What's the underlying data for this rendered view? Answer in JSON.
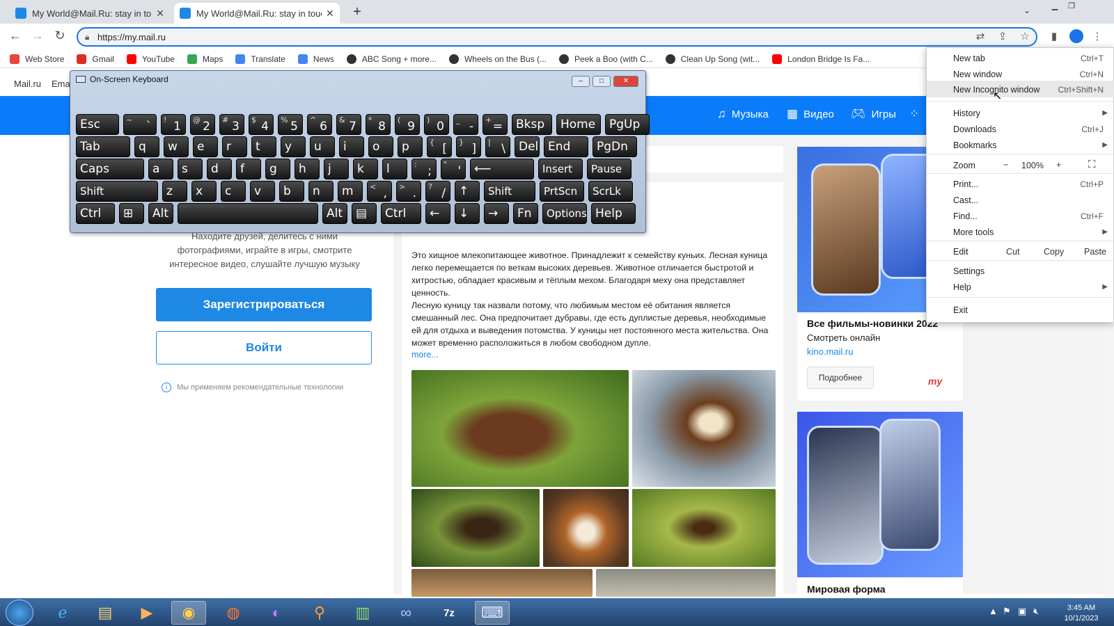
{
  "browser": {
    "tabs": [
      {
        "title": "My World@Mail.Ru: stay in touch",
        "active": false
      },
      {
        "title": "My World@Mail.Ru: stay in touch",
        "active": true
      }
    ],
    "new_tab_symbol": "+",
    "url": "https://my.mail.ru",
    "bookmarks": [
      {
        "label": "Web Store",
        "icon": "webstore-icon",
        "color": "#e8453c"
      },
      {
        "label": "Gmail",
        "icon": "gmail-icon",
        "color": "#d93025"
      },
      {
        "label": "YouTube",
        "icon": "youtube-icon",
        "color": "#ff0000"
      },
      {
        "label": "Maps",
        "icon": "maps-icon",
        "color": "#34a853"
      },
      {
        "label": "Translate",
        "icon": "translate-icon",
        "color": "#4285f4"
      },
      {
        "label": "News",
        "icon": "news-icon",
        "color": "#4285f4"
      },
      {
        "label": "ABC Song + more...",
        "icon": "globe-icon",
        "color": "#333333"
      },
      {
        "label": "Wheels on the Bus (...",
        "icon": "globe-icon",
        "color": "#333333"
      },
      {
        "label": "Peek a Boo (with C...",
        "icon": "globe-icon",
        "color": "#333333"
      },
      {
        "label": "Clean Up Song (wit...",
        "icon": "globe-icon",
        "color": "#333333"
      },
      {
        "label": "London Bridge Is Fa...",
        "icon": "youtube-icon",
        "color": "#ff0000"
      }
    ]
  },
  "site": {
    "nav_left": [
      "Mail.ru",
      "Ema"
    ],
    "blue_nav": [
      {
        "label": "Музыка",
        "icon": "music-icon"
      },
      {
        "label": "Видео",
        "icon": "video-icon"
      },
      {
        "label": "Игры",
        "icon": "gamepad-icon"
      }
    ],
    "intro_lines": [
      "Находите друзей, делитесь с ними",
      "фотографиями, играйте в игры, смотрите",
      "интересное видео, слушайте лучшую музыку"
    ],
    "register_button": "Зарегистрироваться",
    "login_button": "Войти",
    "tech_note": "Мы применяем рекомендательные технологии",
    "article_p1": "Это хищное млекопитающее животное. Принадлежит к семейству куньих. Лесная куница легко перемещается по веткам высоких деревьев. Животное отличается быстротой и хитростью, обладает красивым и тёплым мехом. Благодаря меху она представляет ценность.",
    "article_p2": "Лесную куницу так назвали потому, что любимым местом её обитания является смешанный лес. Она предпочитает дубравы, где есть дуплистые деревья, необходимые ей для отдыха и выведения потомства. У куницы нет постоянного места жительства. Она может временно расположиться в любом свободном дупле.",
    "more_link": "more...",
    "ad1": {
      "title": "Все фильмы-новинки 2022",
      "subtitle": "Смотреть онлайн",
      "link": "kino.mail.ru",
      "button": "Подробнее",
      "logo": "my"
    },
    "ad2": {
      "title": "Мировая форма"
    }
  },
  "osk": {
    "title": "On-Screen Keyboard",
    "rows": [
      [
        {
          "s": "",
          "m": "Esc"
        },
        {
          "s": "~",
          "m": "`"
        },
        {
          "s": "!",
          "m": "1"
        },
        {
          "s": "@",
          "m": "2"
        },
        {
          "s": "#",
          "m": "3"
        },
        {
          "s": "$",
          "m": "4"
        },
        {
          "s": "%",
          "m": "5"
        },
        {
          "s": "^",
          "m": "6"
        },
        {
          "s": "&",
          "m": "7"
        },
        {
          "s": "*",
          "m": "8"
        },
        {
          "s": "(",
          "m": "9"
        },
        {
          "s": ")",
          "m": "0"
        },
        {
          "s": "_",
          "m": "-"
        },
        {
          "s": "+",
          "m": "="
        },
        {
          "s": "",
          "m": "Bksp"
        },
        {
          "s": "",
          "m": "Home"
        },
        {
          "s": "",
          "m": "PgUp"
        }
      ],
      [
        {
          "s": "",
          "m": "Tab"
        },
        {
          "s": "",
          "m": "q"
        },
        {
          "s": "",
          "m": "w"
        },
        {
          "s": "",
          "m": "e"
        },
        {
          "s": "",
          "m": "r"
        },
        {
          "s": "",
          "m": "t"
        },
        {
          "s": "",
          "m": "y"
        },
        {
          "s": "",
          "m": "u"
        },
        {
          "s": "",
          "m": "i"
        },
        {
          "s": "",
          "m": "o"
        },
        {
          "s": "",
          "m": "p"
        },
        {
          "s": "{",
          "m": "["
        },
        {
          "s": "}",
          "m": "]"
        },
        {
          "s": "|",
          "m": "\\"
        },
        {
          "s": "",
          "m": "Del"
        },
        {
          "s": "",
          "m": "End"
        },
        {
          "s": "",
          "m": "PgDn"
        }
      ],
      [
        {
          "s": "",
          "m": "Caps"
        },
        {
          "s": "",
          "m": "a"
        },
        {
          "s": "",
          "m": "s"
        },
        {
          "s": "",
          "m": "d"
        },
        {
          "s": "",
          "m": "f"
        },
        {
          "s": "",
          "m": "g"
        },
        {
          "s": "",
          "m": "h"
        },
        {
          "s": "",
          "m": "j"
        },
        {
          "s": "",
          "m": "k"
        },
        {
          "s": "",
          "m": "l"
        },
        {
          "s": ":",
          "m": ";"
        },
        {
          "s": "\"",
          "m": "'"
        },
        {
          "s": "",
          "m": "⟵"
        },
        {
          "s": "",
          "m": "Insert"
        },
        {
          "s": "",
          "m": "Pause"
        }
      ],
      [
        {
          "s": "",
          "m": "Shift"
        },
        {
          "s": "",
          "m": "z"
        },
        {
          "s": "",
          "m": "x"
        },
        {
          "s": "",
          "m": "c"
        },
        {
          "s": "",
          "m": "v"
        },
        {
          "s": "",
          "m": "b"
        },
        {
          "s": "",
          "m": "n"
        },
        {
          "s": "",
          "m": "m"
        },
        {
          "s": "<",
          "m": ","
        },
        {
          "s": ">",
          "m": "."
        },
        {
          "s": "?",
          "m": "/"
        },
        {
          "s": "",
          "m": "↑"
        },
        {
          "s": "",
          "m": "Shift"
        },
        {
          "s": "",
          "m": "PrtScn"
        },
        {
          "s": "",
          "m": "ScrLk"
        }
      ],
      [
        {
          "s": "",
          "m": "Ctrl"
        },
        {
          "s": "",
          "m": "⊞"
        },
        {
          "s": "",
          "m": "Alt"
        },
        {
          "s": "",
          "m": ""
        },
        {
          "s": "",
          "m": "Alt"
        },
        {
          "s": "",
          "m": "▤"
        },
        {
          "s": "",
          "m": "Ctrl"
        },
        {
          "s": "",
          "m": "←"
        },
        {
          "s": "",
          "m": "↓"
        },
        {
          "s": "",
          "m": "→"
        },
        {
          "s": "",
          "m": "Fn"
        },
        {
          "s": "",
          "m": "Options"
        },
        {
          "s": "",
          "m": "Help"
        }
      ]
    ]
  },
  "menu": {
    "new_tab": {
      "label": "New tab",
      "shortcut": "Ctrl+T"
    },
    "new_window": {
      "label": "New window",
      "shortcut": "Ctrl+N"
    },
    "new_incognito": {
      "label": "New Incognito window",
      "shortcut": "Ctrl+Shift+N"
    },
    "history": {
      "label": "History"
    },
    "downloads": {
      "label": "Downloads",
      "shortcut": "Ctrl+J"
    },
    "bookmarks": {
      "label": "Bookmarks"
    },
    "zoom": {
      "label": "Zoom",
      "minus": "−",
      "value": "100%",
      "plus": "+"
    },
    "print": {
      "label": "Print...",
      "shortcut": "Ctrl+P"
    },
    "cast": {
      "label": "Cast..."
    },
    "find": {
      "label": "Find...",
      "shortcut": "Ctrl+F"
    },
    "more_tools": {
      "label": "More tools"
    },
    "edit": {
      "label": "Edit",
      "cut": "Cut",
      "copy": "Copy",
      "paste": "Paste"
    },
    "settings": {
      "label": "Settings"
    },
    "help": {
      "label": "Help"
    },
    "exit": {
      "label": "Exit"
    }
  },
  "taskbar": {
    "clock_time": "3:45 AM",
    "clock_date": "10/1/2023",
    "apps": [
      "ie-icon",
      "explorer-icon",
      "media-player-icon",
      "chrome-icon",
      "firefox-icon",
      "mask-app-icon",
      "search-app-icon",
      "chart-app-icon",
      "infinity-app-icon",
      "7zip-icon",
      "keyboard-app-icon"
    ]
  }
}
